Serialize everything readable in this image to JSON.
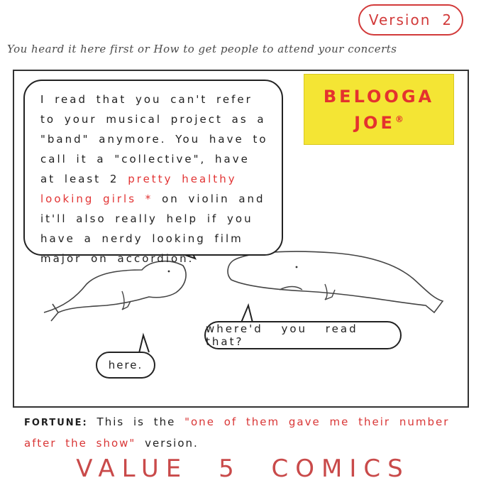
{
  "header": {
    "version_label": "Version",
    "version_number": "2",
    "subtitle": "You heard it here first or How to get people to attend your concerts"
  },
  "panel": {
    "main_bubble": {
      "text_before": "I read that you can't refer to your musical project as a \"band\" anymore. You have to call it a \"collective\", have at least 2",
      "highlight": "pretty healthy looking girls *",
      "text_after": "on violin and it'll also really help if you have a nerdy looking film major on accordion."
    },
    "logo": {
      "line1": "BELOOGA",
      "line2": "JOE",
      "mark": "®"
    },
    "reply_bubble": "where'd you read that?",
    "here_bubble": "here."
  },
  "footer": {
    "label": "FORTUNE:",
    "text_before": "This is the",
    "highlight": "\"one of them gave me their number after the show\"",
    "text_after": "version."
  },
  "brand": "VALUE 5 COMICS",
  "colors": {
    "accent_red": "#d93636",
    "logo_yellow": "#f4e534",
    "ink": "#1f1f1f"
  }
}
